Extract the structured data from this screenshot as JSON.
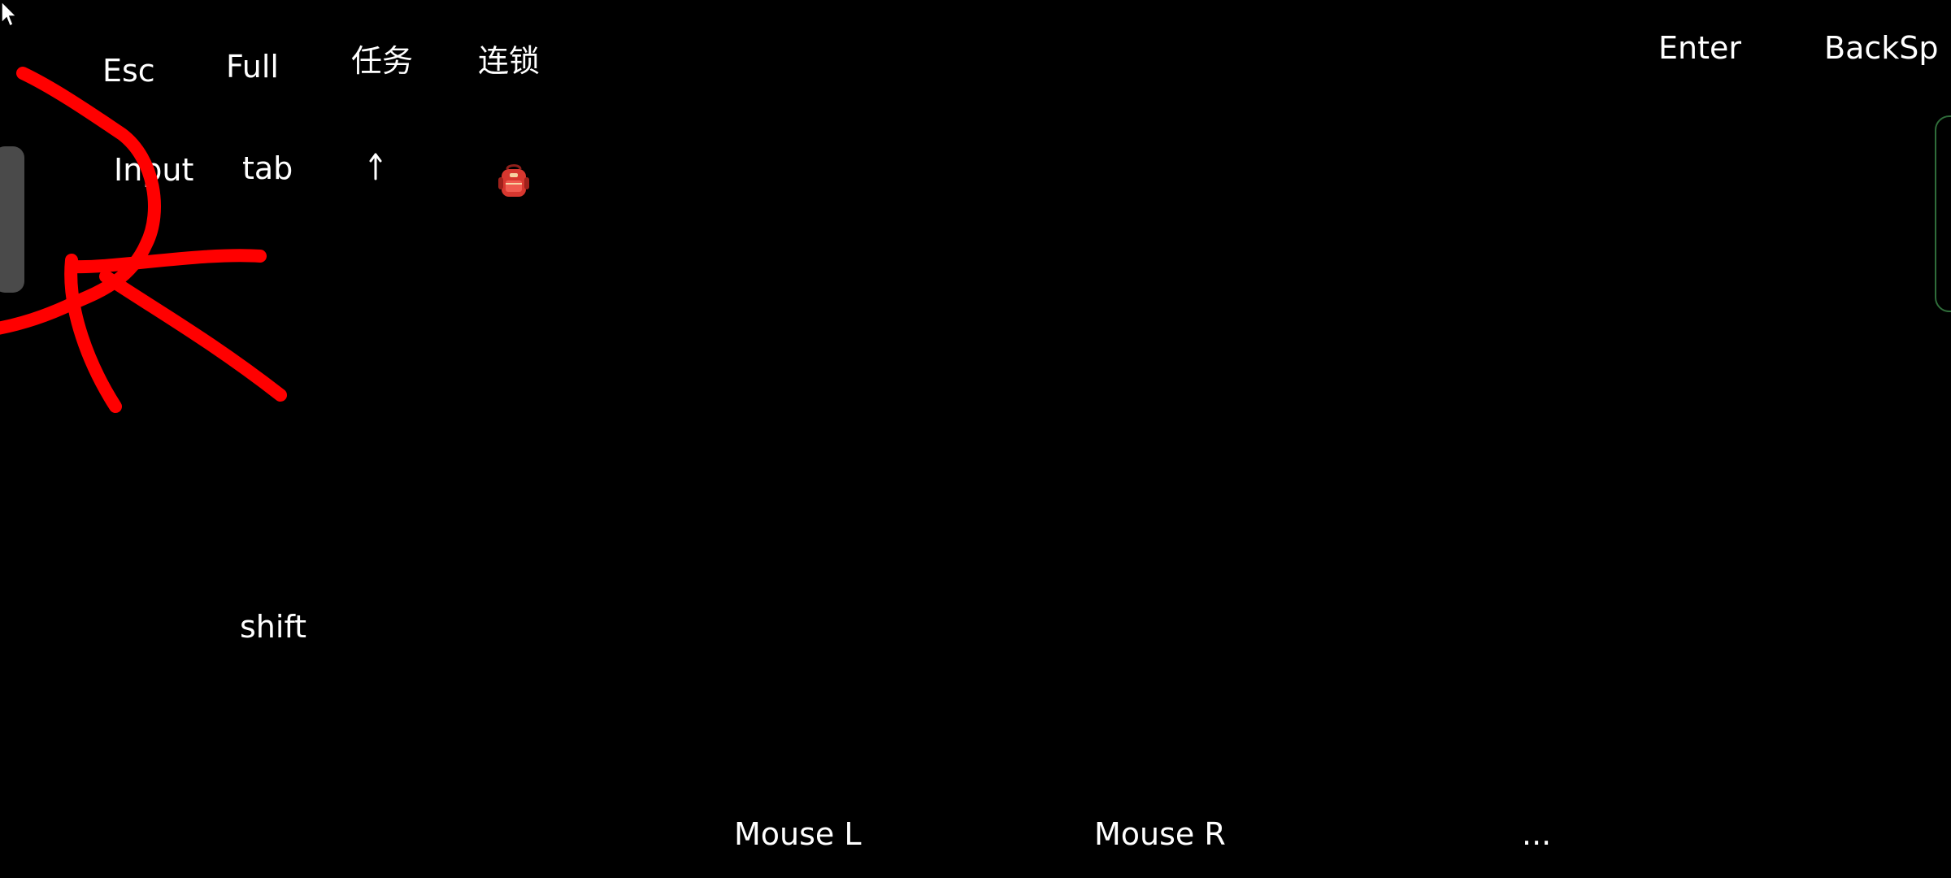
{
  "keys": {
    "esc": "Esc",
    "full": "Full",
    "task": "任务",
    "combo": "连锁",
    "enter": "Enter",
    "backspace": "BackSp",
    "input": "Input",
    "tab": "tab",
    "shift": "shift",
    "mouse_left": "Mouse L",
    "mouse_right": "Mouse R",
    "more": "..."
  },
  "icons": {
    "arrow_up": "arrow-up-icon",
    "backpack": "backpack-icon",
    "cursor": "mouse-cursor-icon"
  },
  "colors": {
    "background": "#000000",
    "text": "#ffffff",
    "stroke": "#ff0000",
    "left_handle": "#4a4a4a",
    "right_handle_border": "#2f6d3a",
    "backpack": "#d7372f"
  }
}
